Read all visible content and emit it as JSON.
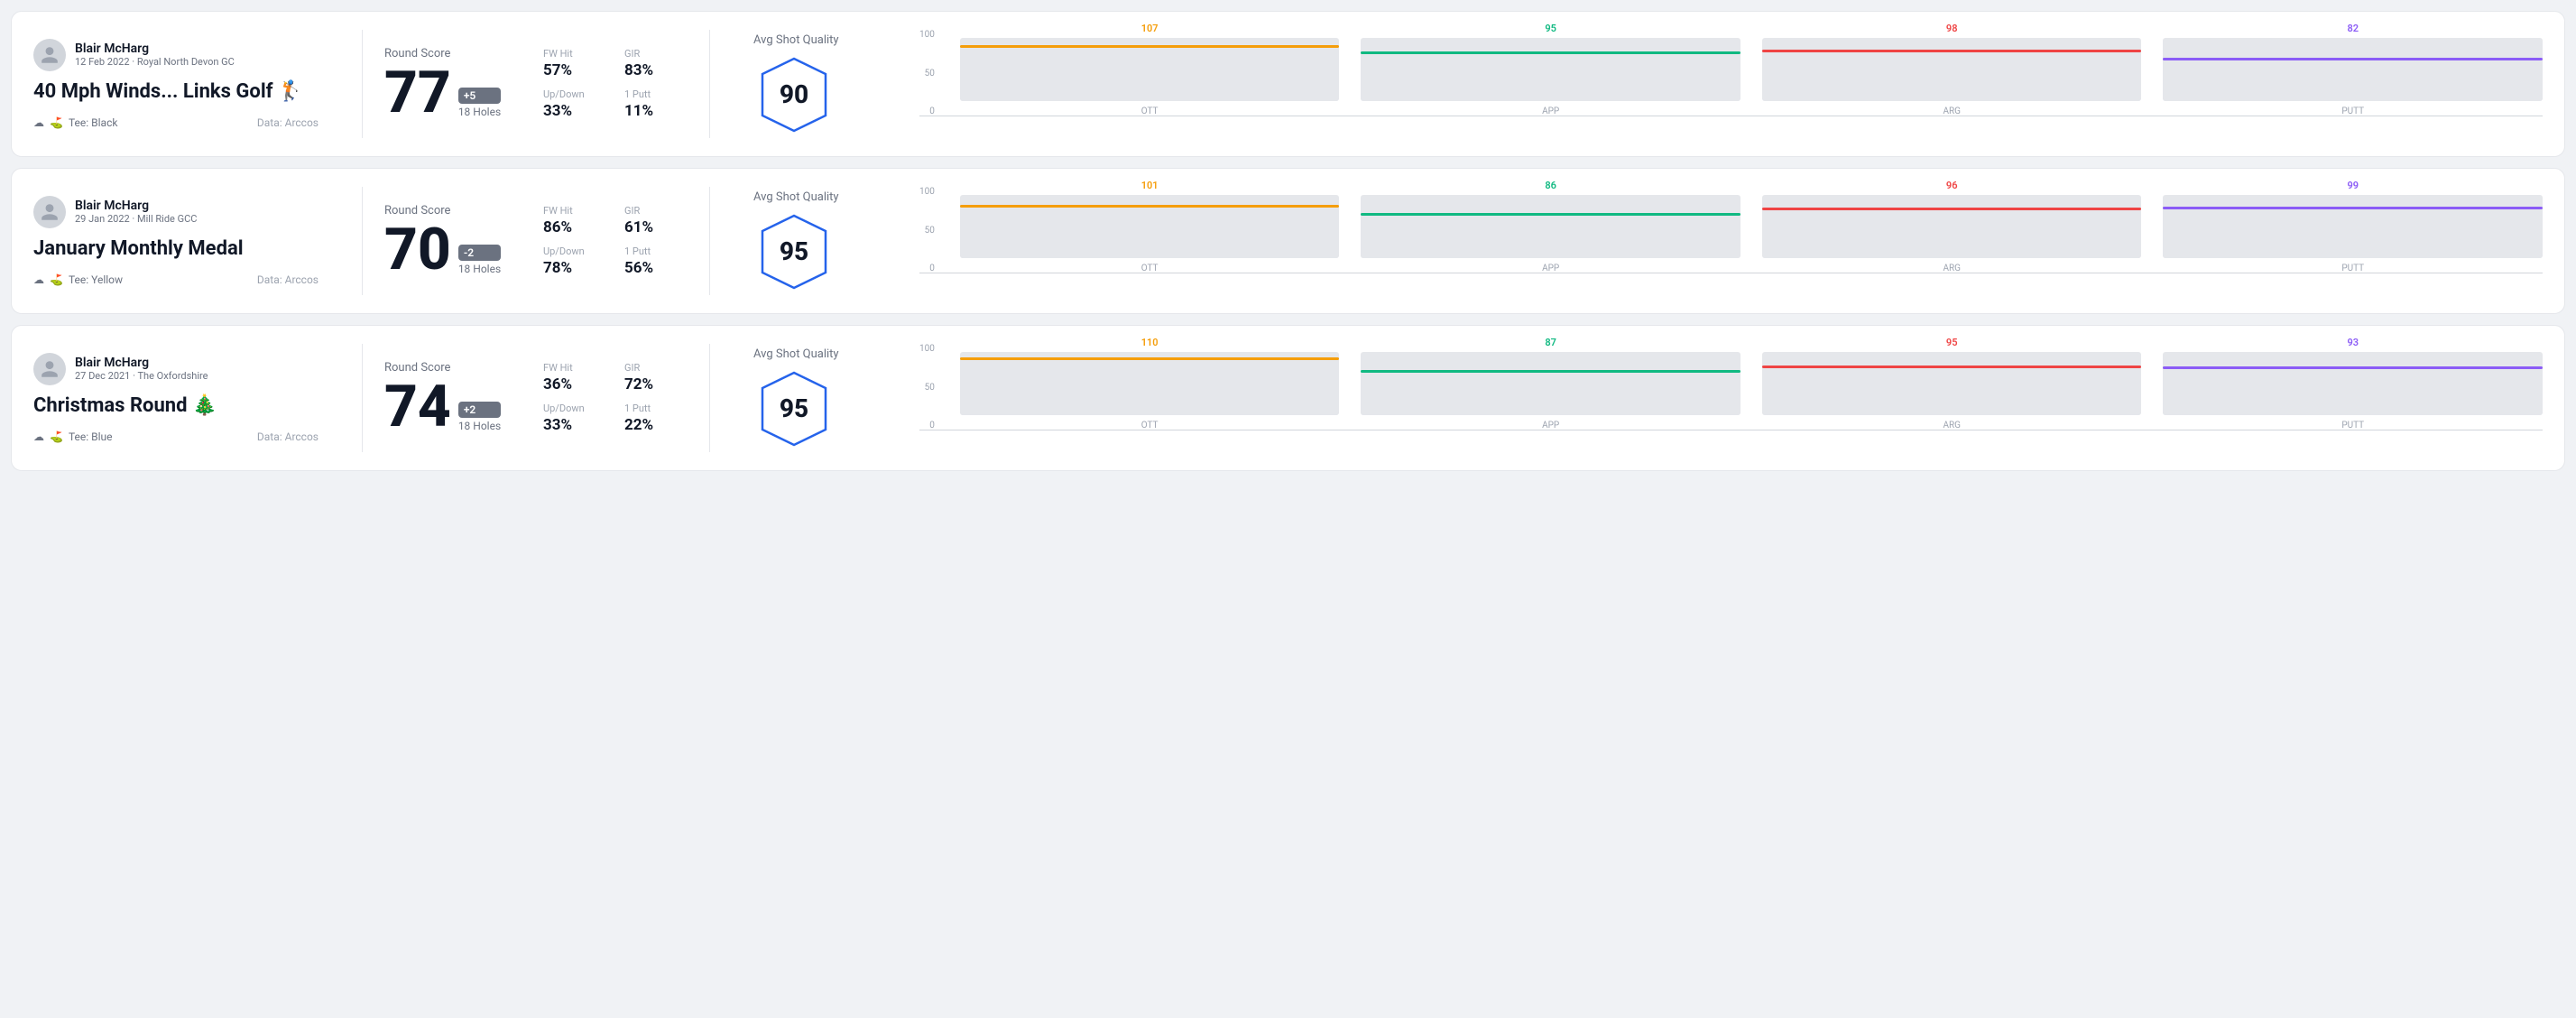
{
  "rounds": [
    {
      "id": "round-1",
      "user": {
        "name": "Blair McHarg",
        "meta": "12 Feb 2022 · Royal North Devon GC"
      },
      "title": "40 Mph Winds... Links Golf 🏌️",
      "tee": "Black",
      "data_source": "Data: Arccos",
      "score": {
        "value": "77",
        "badge": "+5",
        "badge_type": "positive",
        "holes": "18 Holes"
      },
      "stats": {
        "fw_hit": "57%",
        "gir": "83%",
        "up_down": "33%",
        "one_putt": "11%"
      },
      "quality": {
        "label": "Avg Shot Quality",
        "score": "90"
      },
      "chart": {
        "bars": [
          {
            "label": "OTT",
            "value": 107,
            "color": "#f59e0b"
          },
          {
            "label": "APP",
            "value": 95,
            "color": "#10b981"
          },
          {
            "label": "ARG",
            "value": 98,
            "color": "#ef4444"
          },
          {
            "label": "PUTT",
            "value": 82,
            "color": "#8b5cf6"
          }
        ],
        "max": 120
      }
    },
    {
      "id": "round-2",
      "user": {
        "name": "Blair McHarg",
        "meta": "29 Jan 2022 · Mill Ride GCC"
      },
      "title": "January Monthly Medal",
      "tee": "Yellow",
      "data_source": "Data: Arccos",
      "score": {
        "value": "70",
        "badge": "-2",
        "badge_type": "negative",
        "holes": "18 Holes"
      },
      "stats": {
        "fw_hit": "86%",
        "gir": "61%",
        "up_down": "78%",
        "one_putt": "56%"
      },
      "quality": {
        "label": "Avg Shot Quality",
        "score": "95"
      },
      "chart": {
        "bars": [
          {
            "label": "OTT",
            "value": 101,
            "color": "#f59e0b"
          },
          {
            "label": "APP",
            "value": 86,
            "color": "#10b981"
          },
          {
            "label": "ARG",
            "value": 96,
            "color": "#ef4444"
          },
          {
            "label": "PUTT",
            "value": 99,
            "color": "#8b5cf6"
          }
        ],
        "max": 120
      }
    },
    {
      "id": "round-3",
      "user": {
        "name": "Blair McHarg",
        "meta": "27 Dec 2021 · The Oxfordshire"
      },
      "title": "Christmas Round 🎄",
      "tee": "Blue",
      "data_source": "Data: Arccos",
      "score": {
        "value": "74",
        "badge": "+2",
        "badge_type": "positive",
        "holes": "18 Holes"
      },
      "stats": {
        "fw_hit": "36%",
        "gir": "72%",
        "up_down": "33%",
        "one_putt": "22%"
      },
      "quality": {
        "label": "Avg Shot Quality",
        "score": "95"
      },
      "chart": {
        "bars": [
          {
            "label": "OTT",
            "value": 110,
            "color": "#f59e0b"
          },
          {
            "label": "APP",
            "value": 87,
            "color": "#10b981"
          },
          {
            "label": "ARG",
            "value": 95,
            "color": "#ef4444"
          },
          {
            "label": "PUTT",
            "value": 93,
            "color": "#8b5cf6"
          }
        ],
        "max": 120
      }
    }
  ],
  "labels": {
    "round_score": "Round Score",
    "avg_shot_quality": "Avg Shot Quality",
    "fw_hit": "FW Hit",
    "gir": "GIR",
    "up_down": "Up/Down",
    "one_putt": "1 Putt",
    "y_axis": [
      "100",
      "50",
      "0"
    ]
  }
}
